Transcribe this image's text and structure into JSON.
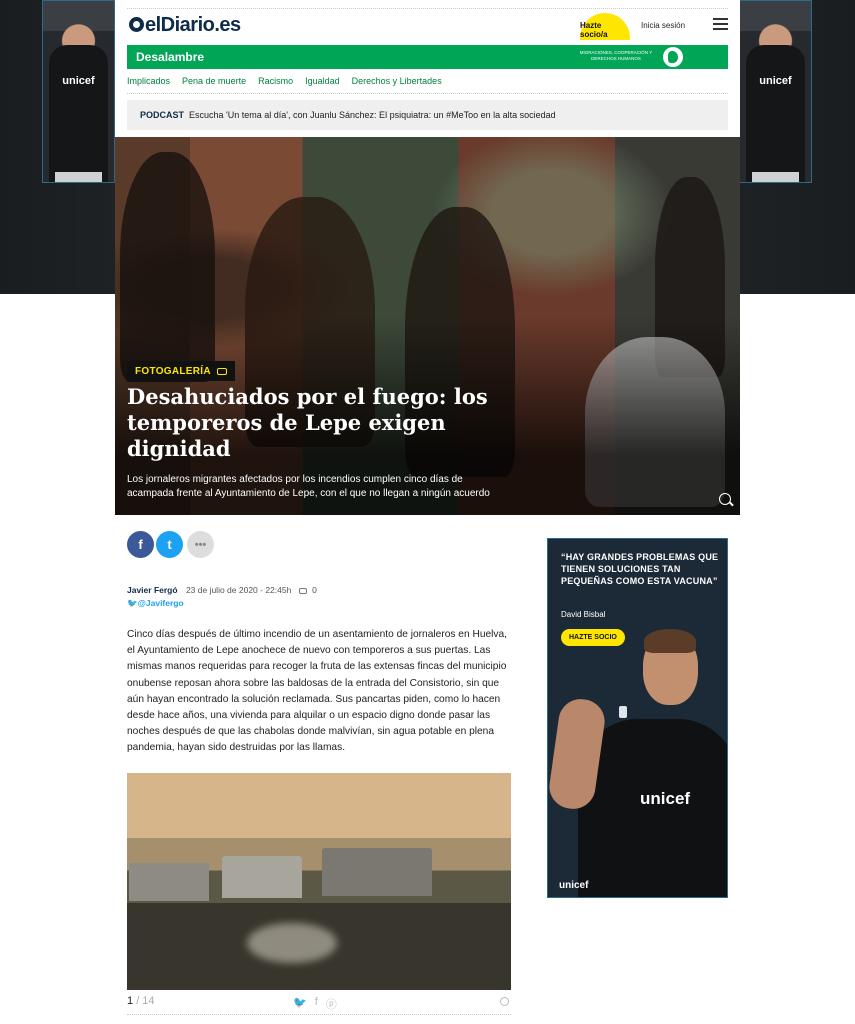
{
  "skin": {
    "brand_label": "unicef"
  },
  "header": {
    "logo_text": "elDiario.es",
    "support_button": "Hazte socio/a",
    "login_link": "Inicia sesión"
  },
  "section": {
    "name": "Desalambre",
    "tagline": "MIGRACIONES, COOPERACIÓN Y DERECHOS HUMANOS"
  },
  "subnav": {
    "items": [
      "Implicados",
      "Pena de muerte",
      "Racismo",
      "Igualdad",
      "Derechos y Libertades"
    ]
  },
  "podcast": {
    "label": "PODCAST",
    "text": "Escucha 'Un tema al día', con Juanlu Sánchez: El psiquiatra: un #MeToo en la alta sociedad"
  },
  "hero": {
    "badge": "FOTOGALERÍA",
    "title": "Desahuciados por el fuego: los temporeros de Lepe exigen dignidad",
    "subtitle": "Los jornaleros migrantes afectados por los incendios cumplen cinco días de acampada frente al Ayuntamiento de Lepe, con el que no llegan a ningún acuerdo"
  },
  "share": {
    "facebook": "f",
    "twitter": "t",
    "more": "•••"
  },
  "article": {
    "author": "Javier Fergó",
    "date": "23 de julio de 2020 - 22:45h",
    "comments": "0",
    "handle": "@Javifergo",
    "body": "Cinco días después de último incendio de un asentamiento de jornaleros en Huelva, el Ayuntamiento de Lepe anochece de nuevo con temporeros a sus puertas. Las mismas manos requeridas para recoger la fruta de las extensas fincas del municipio onubense reposan ahora sobre las baldosas de la entrada del Consistorio, sin que aún hayan encontrado la solución reclamada. Sus pancartas piden, como lo hacen desde hace años, una vivienda para alquilar o un espacio digno donde pasar las noches después de que las chabolas donde malvivían, sin agua potable en plena pandemia, hayan sido destruidas por las llamas."
  },
  "gallery": {
    "current": "1",
    "total": "/ 14"
  },
  "ad": {
    "quote": "“HAY GRANDES PROBLEMAS QUE TIENEN SOLUCIONES TAN PEQUEÑAS COMO ESTA VACUNA”",
    "person": "David Bisbal",
    "cta": "HAZTE SOCIO",
    "brand": "unicef"
  },
  "colors": {
    "section_green": "#00a556",
    "link_green": "#00813f",
    "brand_navy": "#0f2b4b",
    "accent_yellow": "#ffe600"
  }
}
